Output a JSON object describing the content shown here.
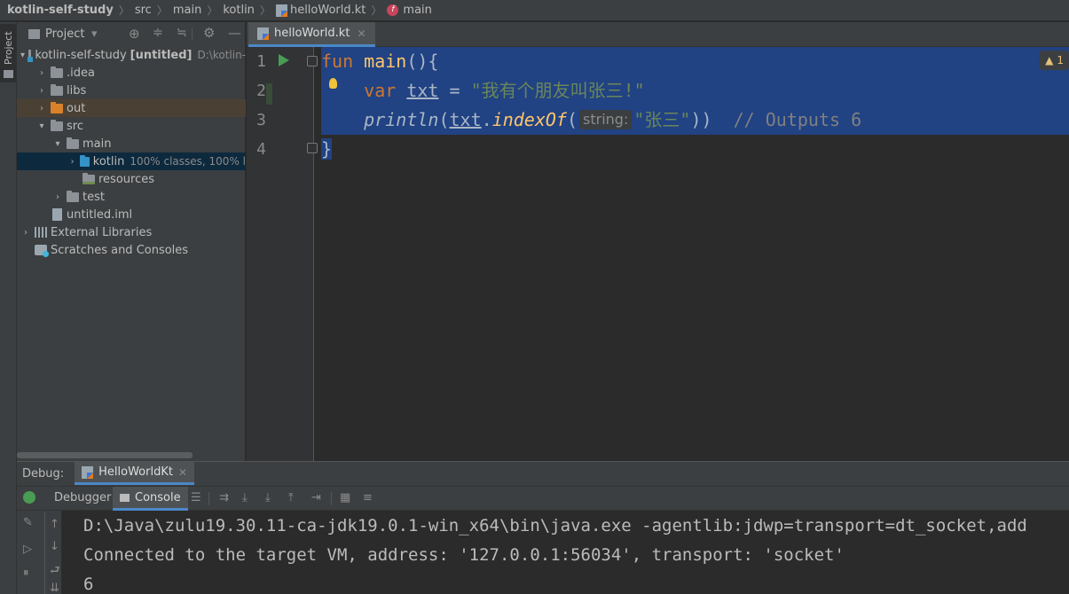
{
  "breadcrumb": {
    "project": "kotlin-self-study",
    "path": [
      "src",
      "main",
      "kotlin"
    ],
    "file": "helloWorld.kt",
    "symbol": "main"
  },
  "left_strip": {
    "project_tab": "Project"
  },
  "project_panel": {
    "title": "Project",
    "tree": [
      {
        "label": "kotlin-self-study",
        "bold_suffix": "[untitled]",
        "path": "D:\\kotlin-"
      },
      {
        "label": ".idea"
      },
      {
        "label": "libs"
      },
      {
        "label": "out"
      },
      {
        "label": "src"
      },
      {
        "label": "main"
      },
      {
        "label": "kotlin",
        "coverage": "100% classes, 100% l"
      },
      {
        "label": "resources"
      },
      {
        "label": "test"
      },
      {
        "label": "untitled.iml"
      },
      {
        "label": "External Libraries"
      },
      {
        "label": "Scratches and Consoles"
      }
    ]
  },
  "editor": {
    "tab": "helloWorld.kt",
    "line_numbers": [
      "1",
      "2",
      "3",
      "4"
    ],
    "code": {
      "l1_kw": "fun",
      "l1_fn": "main",
      "l1_rest": "(){",
      "l2_kw": "var",
      "l2_var": "txt",
      "l2_eq": " = ",
      "l2_str": "\"我有个朋友叫张三!\"",
      "l3_fn": "println",
      "l3_open": "(",
      "l3_var": "txt",
      "l3_dot": ".",
      "l3_call": "indexOf",
      "l3_paren": "(",
      "l3_hint": "string:",
      "l3_str": "\"张三\"",
      "l3_close": "))",
      "l3_comment": "// Outputs 6",
      "l4": "}"
    },
    "warnings": "1"
  },
  "debug": {
    "label": "Debug:",
    "session_tab": "HelloWorldKt",
    "tabs": {
      "debugger": "Debugger",
      "console": "Console"
    },
    "console_lines": [
      "D:\\Java\\zulu19.30.11-ca-jdk19.0.1-win_x64\\bin\\java.exe -agentlib:jdwp=transport=dt_socket,add",
      "Connected to the target VM, address: '127.0.0.1:56034', transport: 'socket'",
      "6"
    ]
  }
}
